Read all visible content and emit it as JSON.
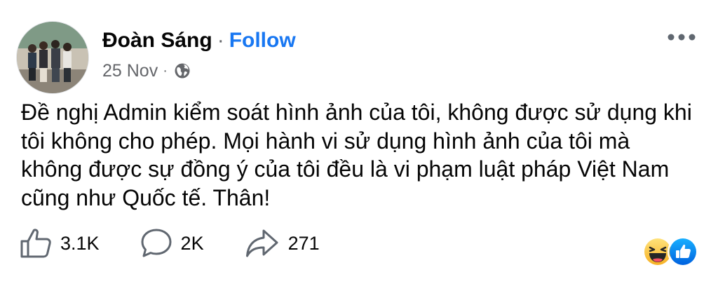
{
  "post": {
    "author": "Đoàn Sáng",
    "separator": "·",
    "follow_label": "Follow",
    "date": "25 Nov",
    "meta_separator": "·",
    "privacy_icon": "globe-icon",
    "more_icon": "more-horizontal-icon",
    "text": "Đề nghị Admin kiểm soát hình ảnh của tôi, không được sử dụng khi\ntôi không cho phép. Mọi hành vi sử dụng hình ảnh của tôi mà\nkhông được sự đồng ý của tôi đều là vi phạm luật pháp Việt Nam\ncũng như Quốc tế. Thân!"
  },
  "actions": {
    "likes": {
      "icon": "thumbs-up-icon",
      "count": "3.1K"
    },
    "comments": {
      "icon": "comment-icon",
      "count": "2K"
    },
    "shares": {
      "icon": "share-icon",
      "count": "271"
    }
  },
  "reactions": [
    "haha-reaction-icon",
    "like-reaction-icon"
  ],
  "colors": {
    "accent": "#1877f2",
    "secondary_text": "#65676b",
    "primary_text": "#050505",
    "icon_gray": "#606770"
  }
}
